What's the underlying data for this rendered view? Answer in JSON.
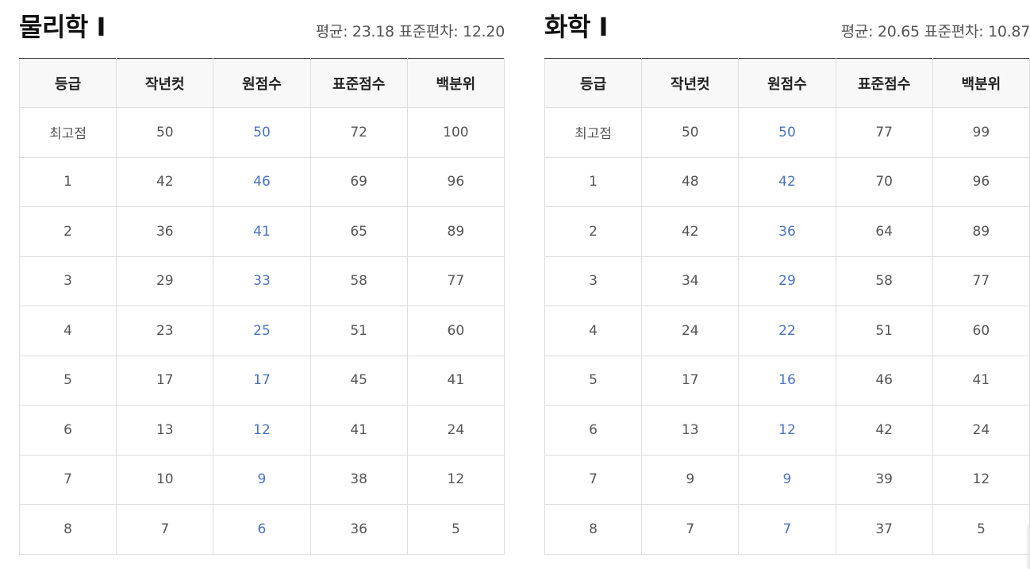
{
  "columns": [
    "등급",
    "작년컷",
    "원점수",
    "표준점수",
    "백분위"
  ],
  "panels": [
    {
      "title": "물리학 Ⅰ",
      "stats": "평균: 23.18 표준편차: 12.20",
      "rows": [
        [
          "최고점",
          "50",
          "50",
          "72",
          "100"
        ],
        [
          "1",
          "42",
          "46",
          "69",
          "96"
        ],
        [
          "2",
          "36",
          "41",
          "65",
          "89"
        ],
        [
          "3",
          "29",
          "33",
          "58",
          "77"
        ],
        [
          "4",
          "23",
          "25",
          "51",
          "60"
        ],
        [
          "5",
          "17",
          "17",
          "45",
          "41"
        ],
        [
          "6",
          "13",
          "12",
          "41",
          "24"
        ],
        [
          "7",
          "10",
          "9",
          "38",
          "12"
        ],
        [
          "8",
          "7",
          "6",
          "36",
          "5"
        ]
      ]
    },
    {
      "title": "화학 Ⅰ",
      "stats": "평균: 20.65 표준편차: 10.87",
      "rows": [
        [
          "최고점",
          "50",
          "50",
          "77",
          "99"
        ],
        [
          "1",
          "48",
          "42",
          "70",
          "96"
        ],
        [
          "2",
          "42",
          "36",
          "64",
          "89"
        ],
        [
          "3",
          "34",
          "29",
          "58",
          "77"
        ],
        [
          "4",
          "24",
          "22",
          "51",
          "60"
        ],
        [
          "5",
          "17",
          "16",
          "46",
          "41"
        ],
        [
          "6",
          "13",
          "12",
          "42",
          "24"
        ],
        [
          "7",
          "9",
          "9",
          "39",
          "12"
        ],
        [
          "8",
          "7",
          "7",
          "37",
          "5"
        ]
      ]
    }
  ],
  "colors": {
    "raw_score": "#4a72c4",
    "header_bg": "#f8f8f8",
    "border": "#dedede",
    "header_top_border": "#333333"
  }
}
